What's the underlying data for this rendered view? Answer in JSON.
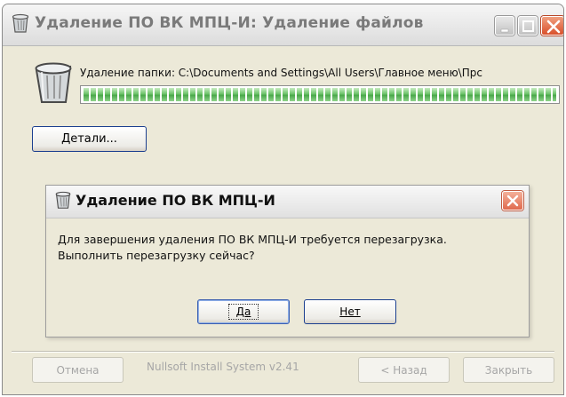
{
  "window": {
    "title": "Удаление ПО ВК МПЦ-И: Удаление файлов",
    "icon": "recycle-bin-icon"
  },
  "progress": {
    "status_text": "Удаление папки: C:\\Documents and Settings\\All Users\\Главное меню\\Прс",
    "fraction": 1.0,
    "bar_color": "#5cb85c"
  },
  "details_button": {
    "label": "Детали..."
  },
  "dialog": {
    "title": "Удаление ПО ВК МПЦ-И",
    "message_line1": "Для завершения удаления ПО ВК МПЦ-И требуется перезагрузка.",
    "message_line2": "Выполнить перезагрузку сейчас?",
    "yes_label": "Да",
    "no_label": "Нет"
  },
  "footer": {
    "cancel_label": "Отмена",
    "brand_text": "Nullsoft Install System v2.41",
    "back_label": "< Назад",
    "close_label": "Закрыть"
  }
}
